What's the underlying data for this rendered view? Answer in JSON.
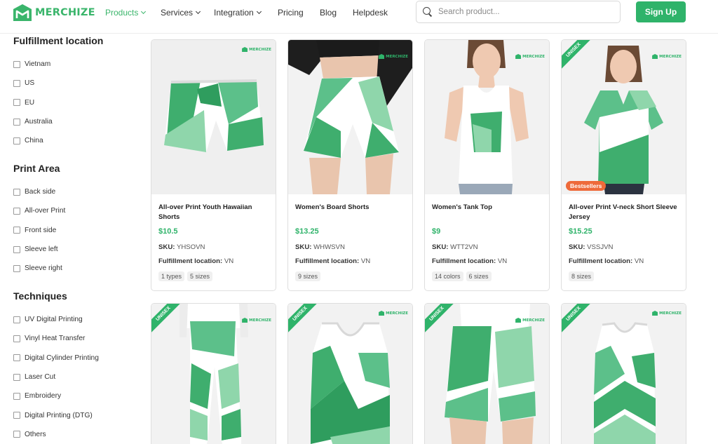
{
  "brand": {
    "name": "MERCHIZE",
    "color": "#3ab56b"
  },
  "nav": [
    {
      "label": "Products",
      "has_dropdown": true,
      "active": true
    },
    {
      "label": "Services",
      "has_dropdown": true,
      "active": false
    },
    {
      "label": "Integration",
      "has_dropdown": true,
      "active": false
    },
    {
      "label": "Pricing",
      "has_dropdown": false,
      "active": false
    },
    {
      "label": "Blog",
      "has_dropdown": false,
      "active": false
    },
    {
      "label": "Helpdesk",
      "has_dropdown": false,
      "active": false
    }
  ],
  "search": {
    "placeholder": "Search product...",
    "value": ""
  },
  "signup": {
    "label": "Sign Up"
  },
  "filters": [
    {
      "title": "Fulfillment location",
      "options": [
        "Vietnam",
        "US",
        "EU",
        "Australia",
        "China"
      ]
    },
    {
      "title": "Print Area",
      "options": [
        "Back side",
        "All-over Print",
        "Front side",
        "Sleeve left",
        "Sleeve right"
      ]
    },
    {
      "title": "Techniques",
      "options": [
        "UV Digital Printing",
        "Vinyl Heat Transfer",
        "Digital Cylinder Printing",
        "Laser Cut",
        "Embroidery",
        "Digital Printing (DTG)",
        "Others"
      ]
    }
  ],
  "card_labels": {
    "sku": "SKU:",
    "location": "Fulfillment location:"
  },
  "watermark": "MERCHIZE",
  "products": [
    {
      "name": "All-over Print Youth Hawaiian Shorts",
      "price": "$10.5",
      "sku": "YHSOVN",
      "location": "VN",
      "tags": [
        "1 types",
        "5 sizes"
      ],
      "badge": "",
      "ribbon": ""
    },
    {
      "name": "Women's Board Shorts",
      "price": "$13.25",
      "sku": "WHWSVN",
      "location": "VN",
      "tags": [
        "9 sizes"
      ],
      "badge": "",
      "ribbon": ""
    },
    {
      "name": "Women's Tank Top",
      "price": "$9",
      "sku": "WTT2VN",
      "location": "VN",
      "tags": [
        "14 colors",
        "6 sizes"
      ],
      "badge": "",
      "ribbon": ""
    },
    {
      "name": "All-over Print V-neck Short Sleeve Jersey",
      "price": "$15.25",
      "sku": "VSSJVN",
      "location": "VN",
      "tags": [
        "8 sizes"
      ],
      "badge": "Bestsellers",
      "ribbon": "UNISEX"
    },
    {
      "ribbon": "UNISEX"
    },
    {
      "ribbon": "UNISEX"
    },
    {
      "ribbon": "UNISEX"
    },
    {
      "ribbon": "UNISEX"
    }
  ]
}
